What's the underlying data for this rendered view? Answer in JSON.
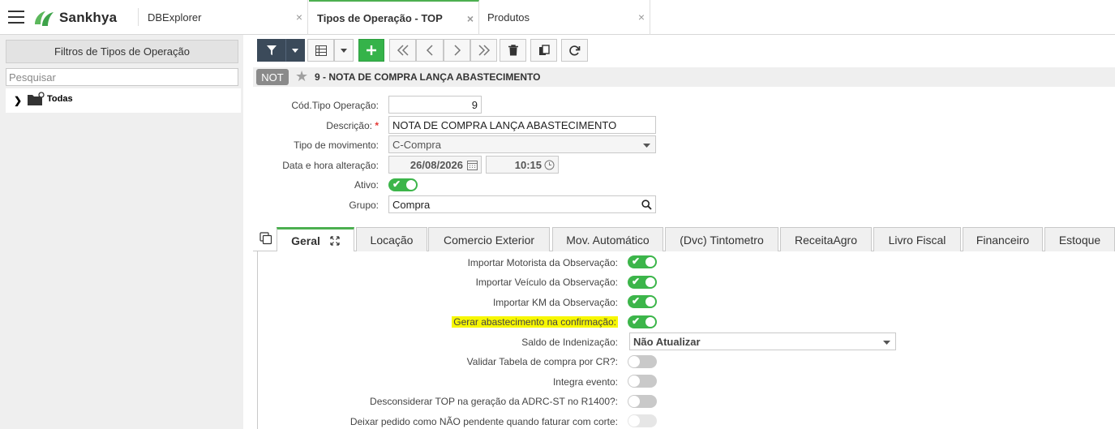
{
  "app": {
    "brand": "Sankhya",
    "accent": "#4caf50"
  },
  "tabs": [
    {
      "label": "DBExplorer",
      "close": "×"
    },
    {
      "label": "Tipos de Operação - TOP",
      "close": "×"
    },
    {
      "label": "Produtos",
      "close": "×"
    }
  ],
  "left": {
    "filter_title": "Filtros de Tipos de Operação",
    "search_placeholder": "Pesquisar",
    "tree_root": "Todas"
  },
  "record": {
    "badge": "NOT",
    "title": "9 - NOTA DE COMPRA LANÇA ABASTECIMENTO"
  },
  "form": {
    "cod_label": "Cód.Tipo Operação:",
    "cod_value": "9",
    "desc_label": "Descrição:",
    "desc_required": "*",
    "desc_value": "NOTA DE COMPRA LANÇA ABASTECIMENTO",
    "mov_label": "Tipo de movimento:",
    "mov_value": "C-Compra",
    "data_label": "Data e hora alteração:",
    "data_value": "26/08/2026",
    "hora_value": "10:15",
    "ativo_label": "Ativo:",
    "grupo_label": "Grupo:",
    "grupo_value": "Compra"
  },
  "detail_tabs": [
    "Geral",
    "Locação",
    "Comercio Exterior",
    "Mov. Automático",
    "(Dvc) Tintometro",
    "ReceitaAgro",
    "Livro Fiscal",
    "Financeiro",
    "Estoque"
  ],
  "geral": {
    "motorista": "Importar Motorista da Observação:",
    "veiculo": "Importar Veículo da Observação:",
    "km": "Importar KM da Observação:",
    "gerar": "Gerar abastecimento na confirmação:",
    "saldo_label": "Saldo de Indenização:",
    "saldo_value": "Não Atualizar",
    "validar": "Validar Tabela de compra por CR?:",
    "integra": "Integra evento:",
    "desconsiderar": "Desconsiderar TOP na geração da ADRC-ST no R1400?:",
    "deixar": "Deixar pedido como NÃO pendente quando faturar com corte:"
  }
}
